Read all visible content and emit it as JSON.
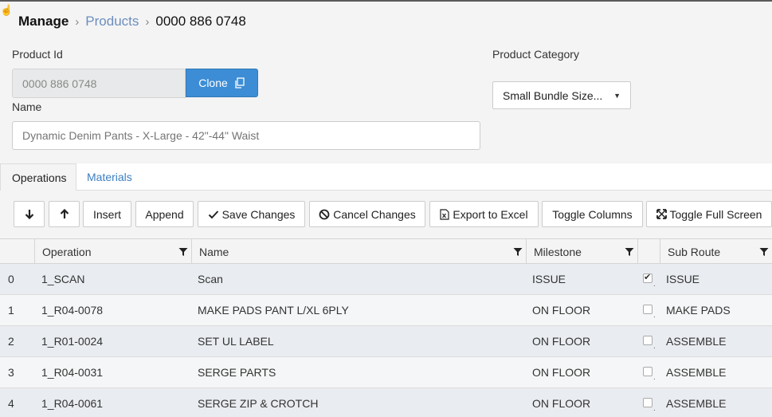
{
  "breadcrumb": {
    "root": "Manage",
    "link": "Products",
    "current": "0000 886 0748"
  },
  "form": {
    "product_id_label": "Product Id",
    "product_id_value": "0000 886 0748",
    "clone_label": "Clone",
    "name_label": "Name",
    "name_placeholder": "Dynamic Denim Pants - X-Large - 42\"-44\" Waist",
    "category_label": "Product Category",
    "category_value": "Small Bundle Size..."
  },
  "tabs": [
    {
      "label": "Operations",
      "active": true
    },
    {
      "label": "Materials",
      "active": false
    }
  ],
  "toolbar": {
    "insert": "Insert",
    "append": "Append",
    "save": "Save Changes",
    "cancel": "Cancel Changes",
    "export": "Export to Excel",
    "toggle_columns": "Toggle Columns",
    "toggle_fullscreen": "Toggle Full Screen"
  },
  "grid": {
    "columns": {
      "operation": "Operation",
      "name": "Name",
      "milestone": "Milestone",
      "sub_route": "Sub Route"
    },
    "rows": [
      {
        "index": "0",
        "operation": "1_SCAN",
        "name": "Scan",
        "milestone": "ISSUE",
        "checked": true,
        "sub_route": "ISSUE"
      },
      {
        "index": "1",
        "operation": "1_R04-0078",
        "name": "MAKE PADS PANT L/XL 6PLY",
        "milestone": "ON FLOOR",
        "checked": false,
        "sub_route": "MAKE PADS"
      },
      {
        "index": "2",
        "operation": "1_R01-0024",
        "name": "SET UL LABEL",
        "milestone": "ON FLOOR",
        "checked": false,
        "sub_route": "ASSEMBLE"
      },
      {
        "index": "3",
        "operation": "1_R04-0031",
        "name": "SERGE PARTS",
        "milestone": "ON FLOOR",
        "checked": false,
        "sub_route": "ASSEMBLE"
      },
      {
        "index": "4",
        "operation": "1_R04-0061",
        "name": "SERGE ZIP & CROTCH",
        "milestone": "ON FLOOR",
        "checked": false,
        "sub_route": "ASSEMBLE"
      }
    ]
  },
  "colors": {
    "accent": "#3c8dd5",
    "link": "#6c8ebf"
  }
}
